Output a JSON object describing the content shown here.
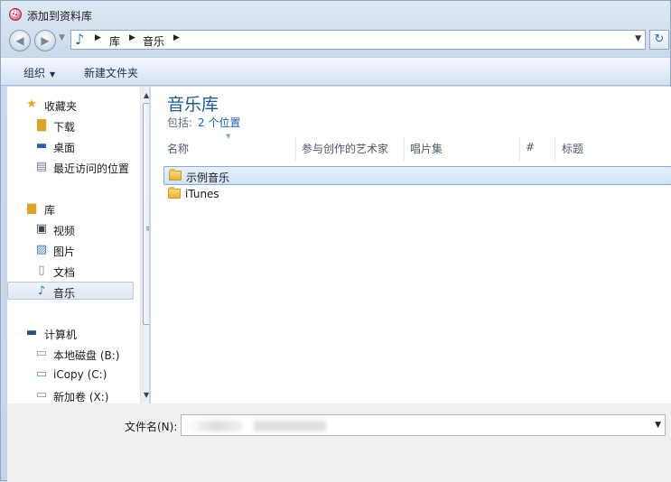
{
  "window": {
    "title": "添加到资料库"
  },
  "nav": {
    "back_icon": "back-arrow-icon",
    "forward_icon": "forward-arrow-icon",
    "breadcrumbs": [
      "库",
      "音乐"
    ]
  },
  "toolbar": {
    "organize_label": "组织",
    "new_folder_label": "新建文件夹"
  },
  "sidebar": {
    "favorites": {
      "label": "收藏夹",
      "items": [
        {
          "label": "下载",
          "icon": "download-folder-icon"
        },
        {
          "label": "桌面",
          "icon": "desktop-icon"
        },
        {
          "label": "最近访问的位置",
          "icon": "recent-places-icon"
        }
      ]
    },
    "libraries": {
      "label": "库",
      "items": [
        {
          "label": "视频",
          "icon": "video-library-icon"
        },
        {
          "label": "图片",
          "icon": "pictures-library-icon"
        },
        {
          "label": "文档",
          "icon": "documents-library-icon"
        },
        {
          "label": "音乐",
          "icon": "music-library-icon",
          "selected": true
        }
      ]
    },
    "computer": {
      "label": "计算机",
      "items": [
        {
          "label": "本地磁盘 (B:)",
          "icon": "drive-icon"
        },
        {
          "label": "iCopy (C:)",
          "icon": "drive-icon"
        },
        {
          "label": "新加卷 (X:)",
          "icon": "drive-icon"
        }
      ]
    }
  },
  "main": {
    "library_title": "音乐库",
    "includes_label": "包括:",
    "includes_link": "2 个位置",
    "columns": [
      "名称",
      "参与创作的艺术家",
      "唱片集",
      "#",
      "标题"
    ],
    "rows": [
      {
        "name": "示例音乐",
        "selected": true
      },
      {
        "name": "iTunes",
        "selected": false
      }
    ]
  },
  "footer": {
    "filename_label": "文件名(N):",
    "filename_value": ""
  },
  "colors": {
    "accent": "#1c5a91",
    "link": "#1a5fb4",
    "selection": "#d2e3f7"
  }
}
